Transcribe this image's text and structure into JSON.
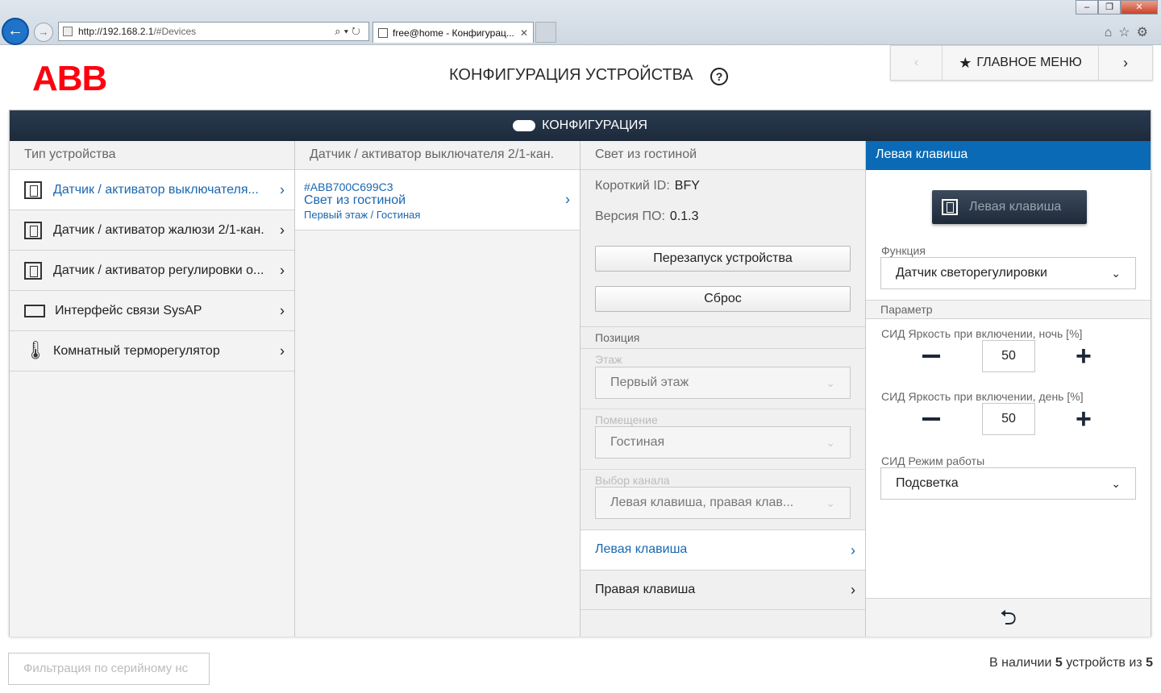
{
  "browser": {
    "url_prefix": "http://",
    "url_host": "192.168.2.1",
    "url_path": "/#Devices",
    "tab_title": "free@home - Конфигурац...",
    "tab_close": "✕"
  },
  "header": {
    "logo": "ABB",
    "title": "КОНФИГУРАЦИЯ УСТРОЙСТВА",
    "help": "?",
    "nav": {
      "prev": "‹",
      "home": "ГЛАВНОЕ МЕНЮ",
      "next": "›"
    }
  },
  "panel": {
    "title": "КОНФИГУРАЦИЯ"
  },
  "col1": {
    "header": "Тип устройства",
    "items": [
      {
        "label": "Датчик / активатор выключателя..."
      },
      {
        "label": "Датчик / активатор жалюзи 2/1-кан."
      },
      {
        "label": "Датчик / активатор регулировки о..."
      },
      {
        "label": "Интерфейс связи SysAP"
      },
      {
        "label": "Комнатный терморегулятор"
      }
    ]
  },
  "col2": {
    "header": "Датчик / активатор выключателя 2/1-кан.",
    "device": {
      "id": "#ABB700C699C3",
      "name": "Свет из гостиной",
      "location": "Первый этаж / Гостиная"
    }
  },
  "col3": {
    "header": "Свет из гостиной",
    "short_id_label": "Короткий ID:",
    "short_id_value": "BFY",
    "fw_label": "Версия ПО:",
    "fw_value": "0.1.3",
    "restart_btn": "Перезапуск устройства",
    "reset_btn": "Сброс",
    "position_label": "Позиция",
    "floor_label": "Этаж",
    "floor_value": "Первый этаж",
    "room_label": "Помещение",
    "room_value": "Гостиная",
    "channel_label": "Выбор канала",
    "channel_value": "Левая клавиша, правая клав...",
    "left_key": "Левая клавиша",
    "right_key": "Правая клавиша"
  },
  "col4": {
    "header": "Левая клавиша",
    "key_button": "Левая клавиша",
    "function_label": "Функция",
    "function_value": "Датчик светорегулировки",
    "param_label": "Параметр",
    "led_night_label": "СИД Яркость при включении, ночь [%]",
    "led_night_value": "50",
    "led_day_label": "СИД Яркость при включении, день [%]",
    "led_day_value": "50",
    "led_mode_label": "СИД Режим работы",
    "led_mode_value": "Подсветка"
  },
  "footer": {
    "filter_placeholder": "Фильтрация по серийному нс",
    "count_prefix": "В наличии",
    "count_available": "5",
    "count_mid": "устройств из",
    "count_total": "5"
  }
}
